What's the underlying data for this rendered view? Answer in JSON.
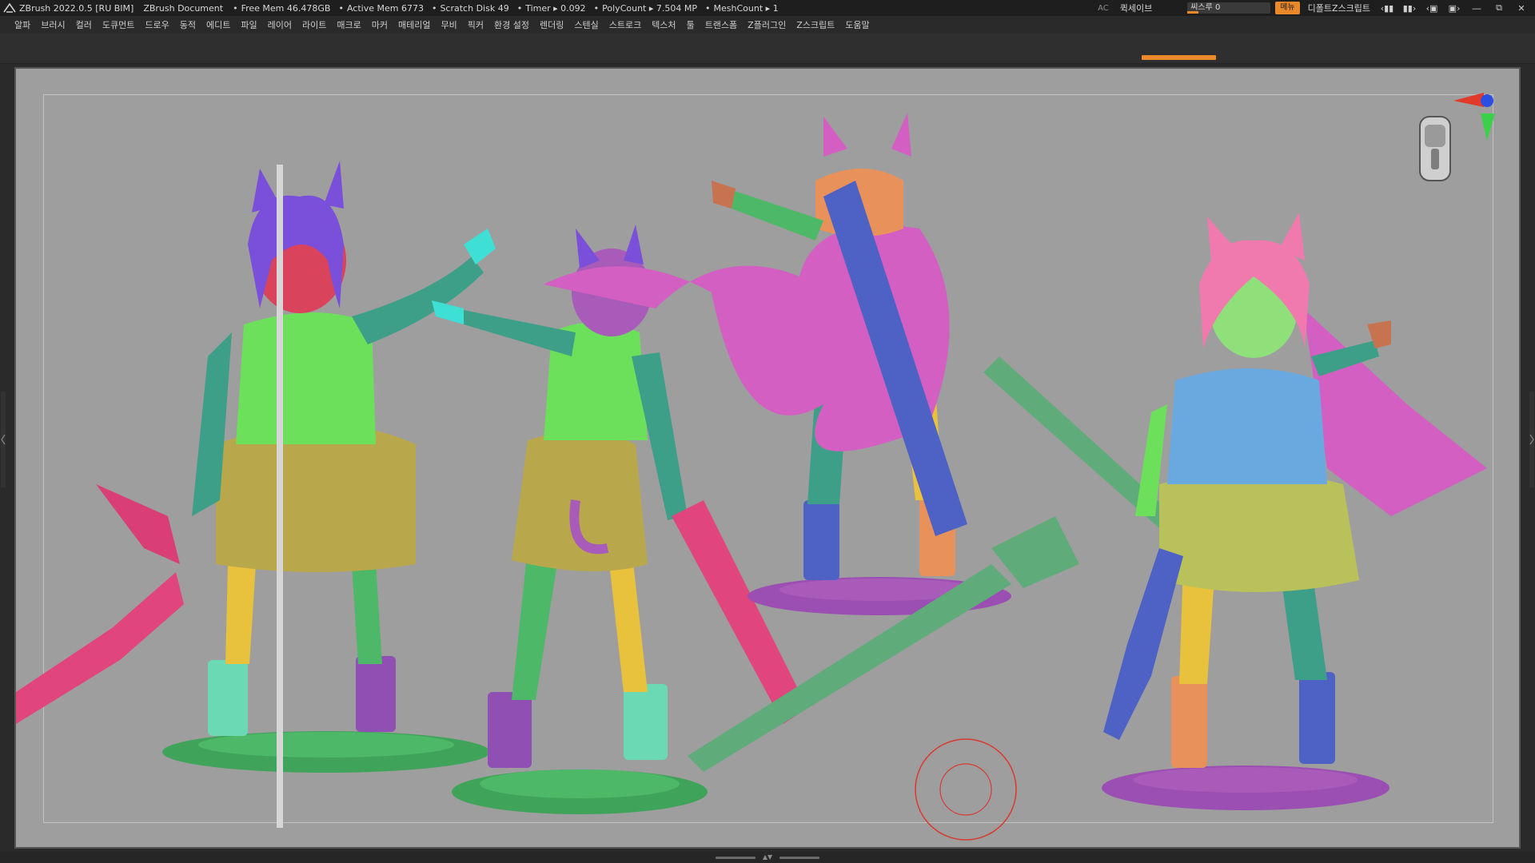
{
  "title_bar": {
    "app_title": "ZBrush 2022.0.5 [RU BIM]",
    "document": "ZBrush Document",
    "stats": [
      "Free Mem 46.478GB",
      "Active Mem 6773",
      "Scratch Disk 49",
      "Timer ▸ 0.092",
      "PolyCount ▸ 7.504 MP",
      "MeshCount ▸ 1"
    ],
    "ac_label": "AC",
    "quicksave_label": "퀵세이브",
    "seethrough_label": "씨스루 0",
    "seethrough_level": 0,
    "menus_button_label": "메뉴",
    "default_script_label": "디폴트Z스크립트"
  },
  "menubar": {
    "items": [
      "알파",
      "브러시",
      "컬러",
      "도큐먼트",
      "드로우",
      "동적",
      "에디트",
      "파일",
      "레이어",
      "라이트",
      "매크로",
      "마커",
      "매테리얼",
      "무비",
      "픽커",
      "환경 설정",
      "렌더링",
      "스텐실",
      "스트로크",
      "텍스처",
      "툴",
      "트랜스폼",
      "Z플러그인",
      "Z스크립트",
      "도움말"
    ]
  },
  "colors": {
    "accent": "#e9892a",
    "viewport_bg": "#9e9e9e",
    "chrome_bg": "#2a2a2a"
  },
  "icons": {
    "logo": "zbrush-logo-icon",
    "gizmo": "axis-gizmo-icon",
    "head": "reference-head-icon",
    "brush_cursor": "brush-cursor-icon"
  }
}
